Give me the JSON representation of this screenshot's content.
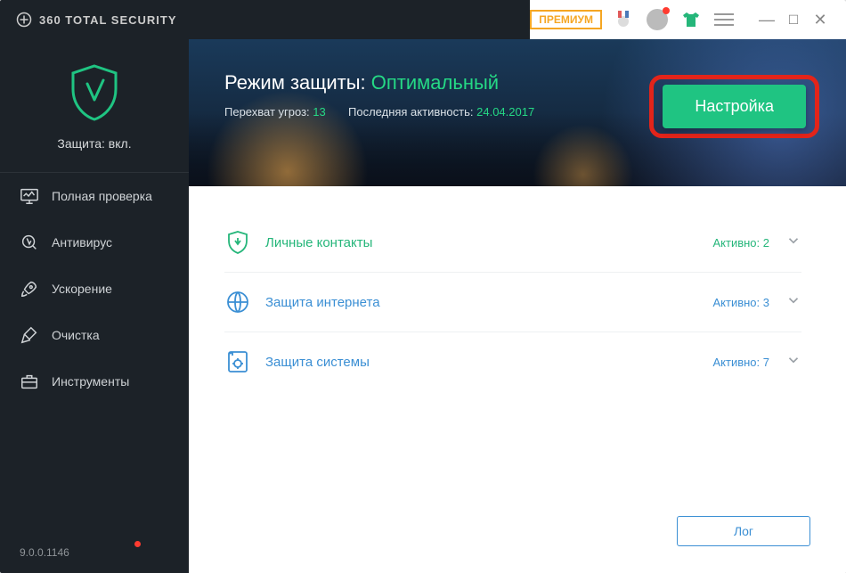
{
  "brand": "360 TOTAL SECURITY",
  "titlebar": {
    "premium": "ПРЕМИУМ"
  },
  "sidebar": {
    "status_label": "Защита: вкл.",
    "items": [
      {
        "label": "Полная проверка"
      },
      {
        "label": "Антивирус"
      },
      {
        "label": "Ускорение"
      },
      {
        "label": "Очистка"
      },
      {
        "label": "Инструменты"
      }
    ],
    "version": "9.0.0.1146"
  },
  "hero": {
    "title_prefix": "Режим защиты:",
    "mode": "Оптимальный",
    "threats_label": "Перехват угроз:",
    "threats_value": "13",
    "last_label": "Последняя активность:",
    "last_value": "24.04.2017",
    "button": "Настройка"
  },
  "sections": [
    {
      "name": "Личные контакты",
      "status_label": "Активно:",
      "count": "2",
      "state": "on"
    },
    {
      "name": "Защита интернета",
      "status_label": "Активно:",
      "count": "3",
      "state": "off"
    },
    {
      "name": "Защита системы",
      "status_label": "Активно:",
      "count": "7",
      "state": "off"
    }
  ],
  "footer": {
    "log_button": "Лог"
  },
  "colors": {
    "accent": "#25b67a",
    "link": "#3b8fd4",
    "highlight_border": "#e3241a"
  }
}
